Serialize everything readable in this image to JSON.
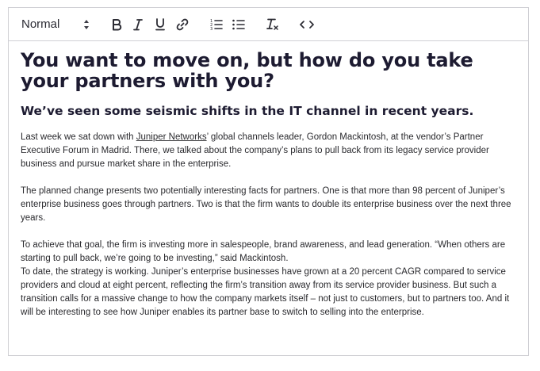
{
  "toolbar": {
    "format_value": "Normal",
    "buttons": [
      "bold",
      "italic",
      "underline",
      "link",
      "ordered-list",
      "bullet-list",
      "clear-formatting",
      "code"
    ]
  },
  "document": {
    "heading1": "You want to move on, but how do you take your partners with you?",
    "heading2": "We’ve seen some seismic shifts in the IT channel in recent years.",
    "p1_before": "Last week we sat down with ",
    "p1_link": "Juniper Networks",
    "p1_after": "’ global channels leader, Gordon Mackintosh, at the vendor’s Partner Executive Forum in Madrid. There, we talked about the company’s plans to pull back from its legacy service provider business and pursue market share in the enterprise.",
    "p2": "The planned change presents two potentially interesting facts for partners. One is that more than 98 percent of Juniper’s enterprise business goes through partners. Two is that the firm wants to double its enterprise business over the next three years.",
    "p3": "To achieve that goal, the firm is investing more in salespeople, brand awareness, and lead generation. “When others are starting to pull back, we’re going to be investing,” said Mackintosh.",
    "p4": "To date, the strategy is working. Juniper’s enterprise businesses have grown at a 20 percent CAGR compared to service providers and cloud at eight percent, reflecting the firm’s transition away from its service provider business. But such a transition calls for a massive change to how the company markets itself – not just to customers, but to partners too. And it will be interesting to see how Juniper enables its partner base to switch to selling into the enterprise."
  }
}
